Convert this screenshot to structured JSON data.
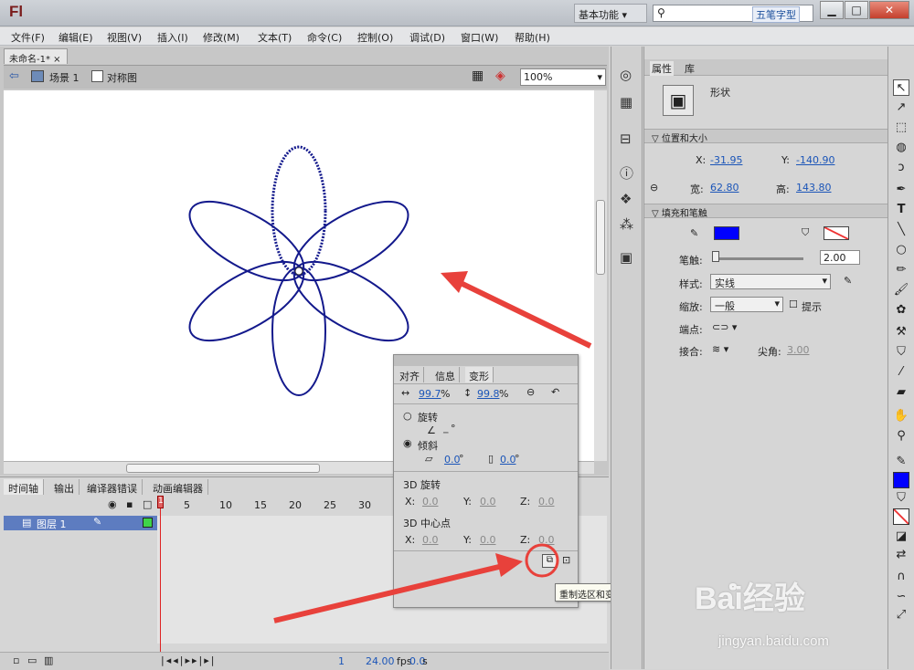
{
  "app": {
    "logo": "Fl",
    "workspace": "基本功能",
    "search_badge": "五笔字型"
  },
  "window_buttons": {
    "minimize": "▁",
    "restore": "□",
    "close": "✕"
  },
  "menu": [
    "文件(F)",
    "编辑(E)",
    "视图(V)",
    "插入(I)",
    "修改(M)",
    "文本(T)",
    "命令(C)",
    "控制(O)",
    "调试(D)",
    "窗口(W)",
    "帮助(H)"
  ],
  "document": {
    "tab": "未命名-1*",
    "scene": "场景 1",
    "symbol": "对称图",
    "zoom": "100%"
  },
  "timeline": {
    "tabs": [
      "时间轴",
      "输出",
      "编译器错误",
      "动画编辑器"
    ],
    "frame_numbers": [
      "1",
      "5",
      "10",
      "15",
      "20",
      "25",
      "30"
    ],
    "layer": "图层 1",
    "status": {
      "frame": "1",
      "fps": "24.00",
      "fps_unit": "fps",
      "time": "0.0",
      "time_unit": "s"
    }
  },
  "transform_panel": {
    "tabs": [
      "对齐",
      "信息",
      "变形"
    ],
    "scale_w": "99.7",
    "scale_h": "99.8",
    "percent": "%",
    "rotate_label": "旋转",
    "rotate_value": "_",
    "degree": "°",
    "skew_label": "倾斜",
    "skew_h": "0.0",
    "skew_v": "0.0",
    "rotation3d_label": "3D 旋转",
    "rotation3d": {
      "x": "0.0",
      "y": "0.0",
      "z": "0.0"
    },
    "center3d_label": "3D 中心点",
    "center3d": {
      "x": "0.0",
      "y": "0.0",
      "z": "0.0"
    },
    "axis_x": "X:",
    "axis_y": "Y:",
    "axis_z": "Z:"
  },
  "tooltip": "重制选区和变形",
  "properties": {
    "tabs": [
      "属性",
      "库"
    ],
    "object_type": "形状",
    "position_section": "位置和大小",
    "x_label": "X:",
    "x": "-31.95",
    "y_label": "Y:",
    "y": "-140.90",
    "w_label": "宽:",
    "w": "62.80",
    "h_label": "高:",
    "h": "143.80",
    "fill_section": "填充和笔触",
    "stroke_color": "#0000ff",
    "stroke_label": "笔触:",
    "stroke_value": "2.00",
    "style_label": "样式:",
    "style_value": "实线",
    "scale_label": "缩放:",
    "scale_value": "一般",
    "hint_label": "提示",
    "cap_label": "端点:",
    "join_label": "接合:",
    "miter_label": "尖角:",
    "miter_value": "3.00"
  },
  "watermark": {
    "main": "Baiໍ经验",
    "sub": "jingyan.baidu.com"
  }
}
